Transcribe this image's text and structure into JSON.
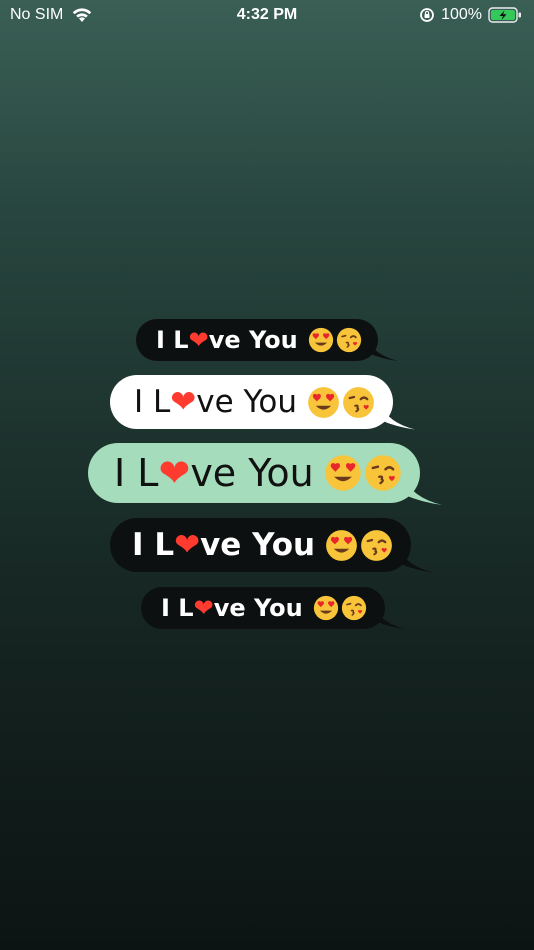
{
  "status_bar": {
    "carrier": "No SIM",
    "time": "4:32 PM",
    "battery_percent": "100%"
  },
  "message": {
    "prefix": "I L",
    "heart": "❤",
    "suffix": "ve You"
  },
  "colors": {
    "bubble_dark": "#0d1010",
    "bubble_white": "#ffffff",
    "bubble_green": "#a4dcbc",
    "heart": "#ff3b30",
    "battery_green": "#34c759"
  },
  "icons": [
    "wifi-icon",
    "rotation-lock-icon",
    "battery-charging-icon",
    "heart-eyes-emoji-icon",
    "kissing-face-emoji-icon"
  ]
}
